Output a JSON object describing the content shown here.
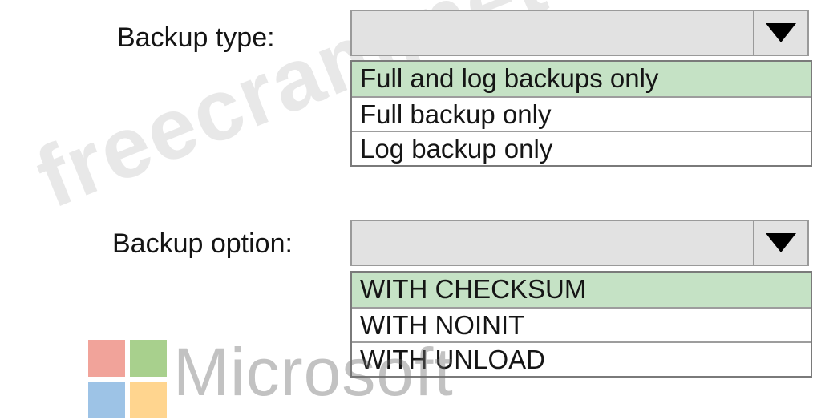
{
  "backup_type": {
    "label": "Backup type:",
    "options": [
      "Full and log backups only",
      "Full backup only",
      "Log backup only"
    ],
    "highlighted_option": "Full and log backups only"
  },
  "backup_option": {
    "label": "Backup option:",
    "options": [
      "WITH CHECKSUM",
      "WITH NOINIT",
      "WITH UNLOAD"
    ],
    "highlighted_option": "WITH CHECKSUM"
  },
  "watermark": {
    "text": "freecram.net"
  },
  "logo": {
    "wordmark": "Microsoft",
    "colors": {
      "red": "#f1a39a",
      "green": "#a8d08d",
      "blue": "#9dc3e6",
      "yellow": "#ffd58f"
    }
  },
  "colors": {
    "highlight": "#c5e2c5",
    "select_background": "#e2e2e2"
  },
  "icons": {
    "dropdown_arrow": "triangle-down-icon"
  }
}
